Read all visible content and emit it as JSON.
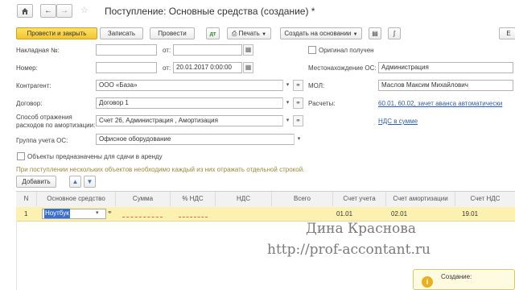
{
  "window": {
    "title": "Поступление: Основные средства (создание) *"
  },
  "nav": {
    "home_icon": "home-icon",
    "back_icon": "arrow-left-icon",
    "forward_icon": "arrow-right-icon",
    "star_icon": "star-icon"
  },
  "toolbar": {
    "post_close": "Провести и закрыть",
    "save": "Записать",
    "post": "Провести",
    "print": "Печать",
    "create_based_on": "Создать на основании",
    "more": "Е"
  },
  "form": {
    "invoice_label": "Накладная №:",
    "invoice_value": "",
    "from1_label": "от:",
    "from1_value": "",
    "original_label": "Оригинал получен",
    "number_label": "Номер:",
    "number_value": "",
    "from2_label": "от:",
    "from2_value": "20.01.2017  0:00:00",
    "location_label": "Местонахождение ОС:",
    "location_value": "Администрация",
    "counterparty_label": "Контрагент:",
    "counterparty_value": "ООО «База»",
    "mol_label": "МОЛ:",
    "mol_value": "Маслов Максим Михайлович",
    "contract_label": "Договор:",
    "contract_value": "Договор 1",
    "settlements_label": "Расчеты:",
    "settlements_link": "60.01, 60.02, зачет аванса автоматически",
    "expense_label_1": "Способ отражения",
    "expense_label_2": "расходов по амортизации:",
    "expense_value": "Счет 26, Администрация , Амортизация",
    "vat_link": "НДС в сумме",
    "group_label": "Группа учета ОС:",
    "group_value": "Офисное оборудование",
    "rent_label": "Объекты предназначены для сдачи в аренду",
    "hint": "При поступлении нескольких объектов необходимо каждый из них отражать отдельной строкой.",
    "add_button": "Добавить"
  },
  "table": {
    "headers": [
      "N",
      "Основное средство",
      "Сумма",
      "% НДС",
      "НДС",
      "Всего",
      "Счет учета",
      "Счет амортизации",
      "Счет НДС"
    ],
    "rows": [
      {
        "n": "1",
        "asset": "Ноутбук",
        "account": "01.01",
        "depr_account": "02.01",
        "vat_account": "19.01"
      }
    ]
  },
  "watermark": {
    "name": "Дина Краснова",
    "url": "http://prof-accontant.ru"
  },
  "popup": {
    "text": "Создание:",
    "icon": "info-icon"
  },
  "colors": {
    "accent": "#f5c42a",
    "row_highlight": "#fdf1b2",
    "link": "#2f5fa8",
    "hint": "#9a8a3a"
  }
}
